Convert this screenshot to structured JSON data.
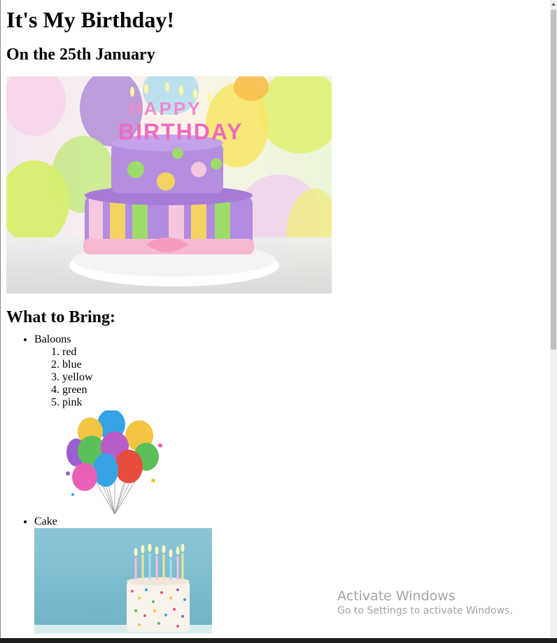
{
  "page": {
    "title": "It's My Birthday!",
    "subtitle": "On the 25th January",
    "bring_heading": "What to Bring:"
  },
  "items": [
    {
      "label": "Baloons",
      "colors": [
        "red",
        "blue",
        "yellow",
        "green",
        "pink"
      ]
    },
    {
      "label": "Cake"
    }
  ],
  "images": {
    "hero_text": "HAPPY BIRTHDAY"
  },
  "watermark": {
    "title": "Activate Windows",
    "subtitle": "Go to Settings to activate Windows."
  }
}
